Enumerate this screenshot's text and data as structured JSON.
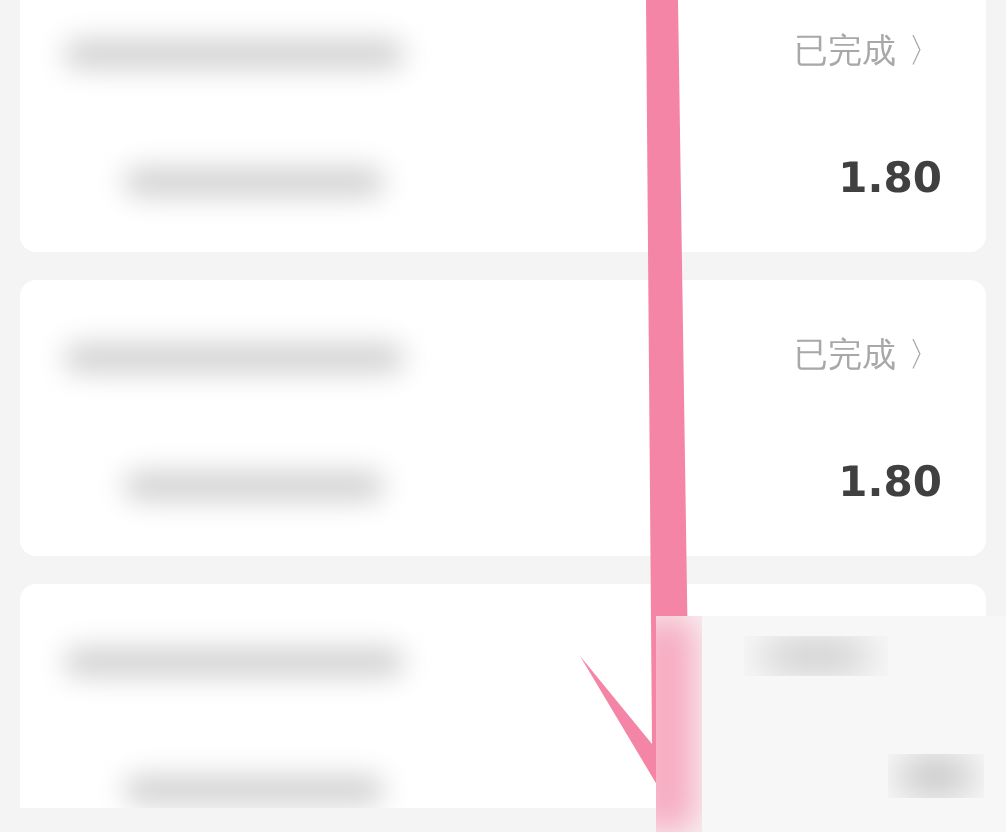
{
  "orders": [
    {
      "status": "已完成",
      "chevron": "〉",
      "amount": "1.80"
    },
    {
      "status": "已完成",
      "chevron": "〉",
      "amount": "1.80"
    }
  ]
}
